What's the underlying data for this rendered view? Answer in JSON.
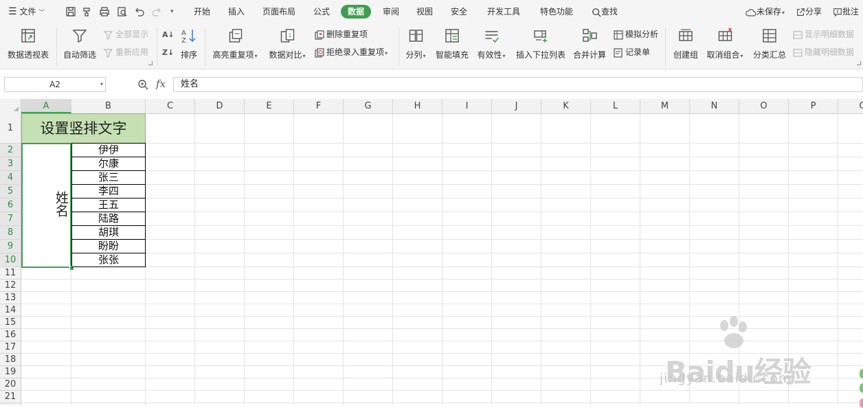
{
  "menubar": {
    "file_label": "文件",
    "tabs": [
      "开始",
      "插入",
      "页面布局",
      "公式",
      "数据",
      "审阅",
      "视图",
      "安全",
      "开发工具",
      "特色功能"
    ],
    "active_tab": "数据",
    "search_label": "查找",
    "unsaved_label": "未保存",
    "share_label": "分享",
    "annotate_label": "批注"
  },
  "ribbon": {
    "pivot": "数据透视表",
    "autofilter": "自动筛选",
    "show_all": "全部显示",
    "reapply": "重新应用",
    "sort": "排序",
    "highlight_dup": "高亮重复项",
    "data_compare": "数据对比",
    "remove_dup": "删除重复项",
    "reject_dup": "拒绝录入重复项",
    "split": "分列",
    "smart_fill": "智能填充",
    "validity": "有效性",
    "insert_dropdown": "插入下拉列表",
    "consolidate": "合并计算",
    "what_if": "模拟分析",
    "record_form": "记录单",
    "create_group": "创建组",
    "ungroup": "取消组合",
    "subtotal": "分类汇总",
    "show_detail": "显示明细数据",
    "hide_detail": "隐藏明细数据"
  },
  "formula_bar": {
    "cell_ref": "A2",
    "fx": "fx",
    "content": "姓名"
  },
  "sheet": {
    "columns": [
      "A",
      "B",
      "C",
      "D",
      "E",
      "F",
      "G",
      "H",
      "I",
      "J",
      "K",
      "L",
      "M",
      "N",
      "O",
      "P",
      "Q"
    ],
    "rows": [
      "1",
      "2",
      "3",
      "4",
      "5",
      "6",
      "7",
      "8",
      "9",
      "10",
      "11",
      "12",
      "13",
      "14",
      "15",
      "16",
      "17",
      "18",
      "19",
      "20",
      "21"
    ],
    "a1": "设置竖排文字",
    "a2": "姓名",
    "b_values": [
      "伊伊",
      "尔康",
      "张三",
      "李四",
      "王五",
      "陆路",
      "胡琪",
      "盼盼",
      "张张"
    ],
    "selected_column": "A",
    "selected_rows": [
      "2",
      "3",
      "4",
      "5",
      "6",
      "7",
      "8",
      "9",
      "10"
    ]
  },
  "watermark": {
    "brand": "Baidu经验",
    "url": "jingyan.baidu.com"
  },
  "colors": {
    "accent": "#3f9e4f",
    "header_fill": "#c6e0b4"
  }
}
